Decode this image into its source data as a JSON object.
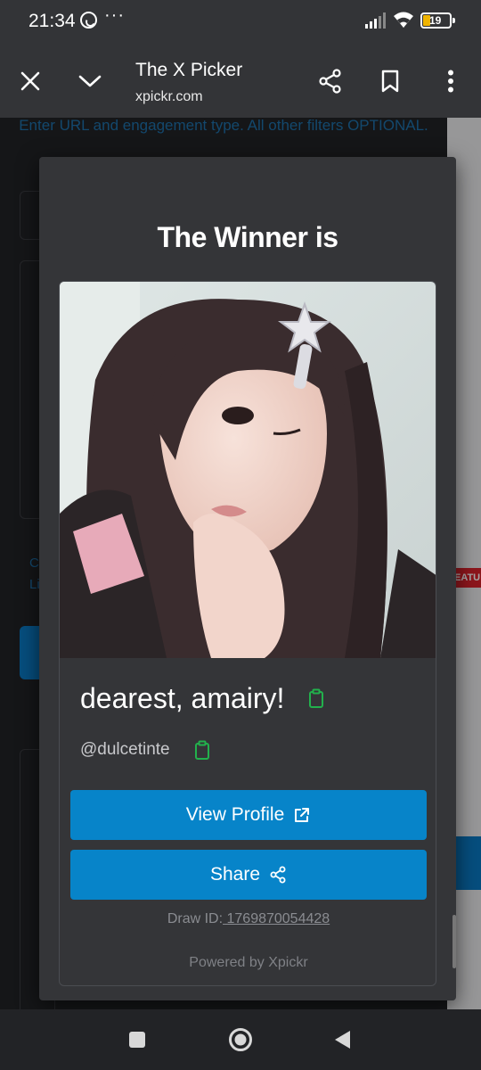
{
  "status_bar": {
    "time": "21:34",
    "more_dots": "···",
    "battery_level": "19",
    "icons": [
      "whatsapp-icon",
      "signal-icon",
      "wifi-icon",
      "battery-icon"
    ]
  },
  "toolbar": {
    "title": "The X Picker",
    "url": "xpickr.com",
    "icons": [
      "close-icon",
      "chevron-down-icon",
      "share-icon",
      "bookmark-icon",
      "more-vert-icon"
    ]
  },
  "background_page": {
    "instructions": "Enter URL and engagement type. All other filters OPTIONAL.",
    "partial_link": "C\nLi",
    "badge": "EATU"
  },
  "modal": {
    "title": "The Winner is",
    "winner_name": "dearest, amairy!",
    "winner_handle": "@dulcetinte",
    "view_profile_label": "View Profile",
    "share_label": "Share",
    "draw_id_label": "Draw ID:",
    "draw_id_value": " 1769870054428",
    "powered_by": "Powered by Xpickr"
  },
  "colors": {
    "accent_blue": "#0784c9",
    "copy_green": "#22b14c",
    "modal_bg": "#343538"
  }
}
